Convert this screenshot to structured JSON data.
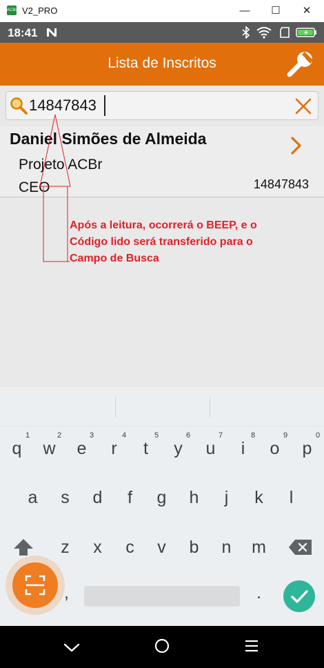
{
  "window": {
    "title": "V2_PRO",
    "app_icon_text": "ACBr",
    "minimize": "—",
    "maximize": "☐",
    "close": "✕"
  },
  "status_bar": {
    "time": "18:41"
  },
  "app_bar": {
    "title": "Lista de Inscritos",
    "settings_icon": "wrench-icon"
  },
  "search": {
    "value": "14847843",
    "search_icon": "search-icon",
    "clear_icon": "close-icon"
  },
  "list": [
    {
      "name": "Daniel Simões de Almeida",
      "project": "Projeto ACBr",
      "role": "CEO",
      "code": "14847843"
    }
  ],
  "annotation": {
    "text": "Após a leitura, ocorrerá o BEEP, e o Código lido será transferido para o Campo de Busca"
  },
  "keyboard": {
    "row1": [
      "q",
      "w",
      "e",
      "r",
      "t",
      "y",
      "u",
      "i",
      "o",
      "p"
    ],
    "row1_numbers": [
      "1",
      "2",
      "3",
      "4",
      "5",
      "6",
      "7",
      "8",
      "9",
      "0"
    ],
    "row2": [
      "a",
      "s",
      "d",
      "f",
      "g",
      "h",
      "j",
      "k",
      "l"
    ],
    "row3": [
      "z",
      "x",
      "c",
      "v",
      "b",
      "n",
      "m"
    ],
    "comma": ",",
    "period": "."
  },
  "colors": {
    "accent": "#e06f0c",
    "annotation": "#e21f26",
    "fab": "#ef7d22",
    "done": "#2fb59a"
  }
}
